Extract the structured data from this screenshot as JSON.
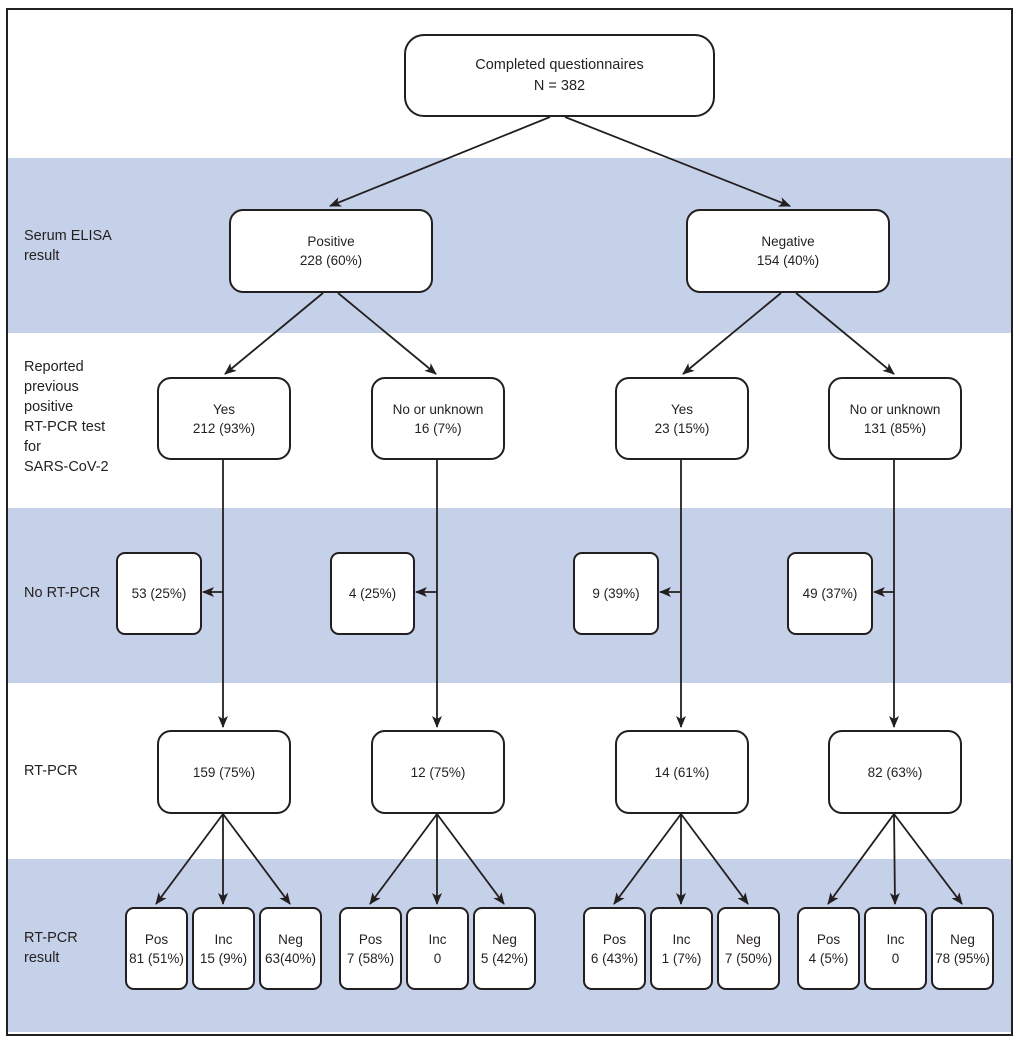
{
  "figure": {
    "type": "flowchart",
    "colors": {
      "band": "#c5d1e8",
      "ink": "#231f20",
      "box": "#ffffff"
    }
  },
  "row_labels": {
    "serum_elisa": "Serum ELISA\nresult",
    "reported_previous": "Reported\nprevious\npositive\nRT-PCR test\nfor\nSARS-CoV-2",
    "no_rtpcr": "No RT-PCR",
    "rtpcr": "RT-PCR",
    "rtpcr_result": "RT-PCR\nresult"
  },
  "root": {
    "title": "Completed questionnaires",
    "value": "N = 382"
  },
  "elisa": {
    "positive": {
      "label": "Positive",
      "value": "228 (60%)"
    },
    "negative": {
      "label": "Negative",
      "value": "154 (40%)"
    }
  },
  "branches": [
    {
      "parent": "positive",
      "reported": {
        "label": "Yes",
        "value": "212 (93%)"
      },
      "no_rtpcr": "53 (25%)",
      "rtpcr": "159 (75%)",
      "results": [
        {
          "label": "Pos",
          "value": "81 (51%)"
        },
        {
          "label": "Inc",
          "value": "15 (9%)"
        },
        {
          "label": "Neg",
          "value": "63(40%)"
        }
      ]
    },
    {
      "parent": "positive",
      "reported": {
        "label": "No or unknown",
        "value": "16 (7%)"
      },
      "no_rtpcr": "4 (25%)",
      "rtpcr": "12 (75%)",
      "results": [
        {
          "label": "Pos",
          "value": "7 (58%)"
        },
        {
          "label": "Inc",
          "value": "0"
        },
        {
          "label": "Neg",
          "value": "5 (42%)"
        }
      ]
    },
    {
      "parent": "negative",
      "reported": {
        "label": "Yes",
        "value": "23 (15%)"
      },
      "no_rtpcr": "9 (39%)",
      "rtpcr": "14 (61%)",
      "results": [
        {
          "label": "Pos",
          "value": "6 (43%)"
        },
        {
          "label": "Inc",
          "value": "1 (7%)"
        },
        {
          "label": "Neg",
          "value": "7 (50%)"
        }
      ]
    },
    {
      "parent": "negative",
      "reported": {
        "label": "No or unknown",
        "value": "131 (85%)"
      },
      "no_rtpcr": "49 (37%)",
      "rtpcr": "82 (63%)",
      "results": [
        {
          "label": "Pos",
          "value": "4 (5%)"
        },
        {
          "label": "Inc",
          "value": "0"
        },
        {
          "label": "Neg",
          "value": "78 (95%)"
        }
      ]
    }
  ]
}
